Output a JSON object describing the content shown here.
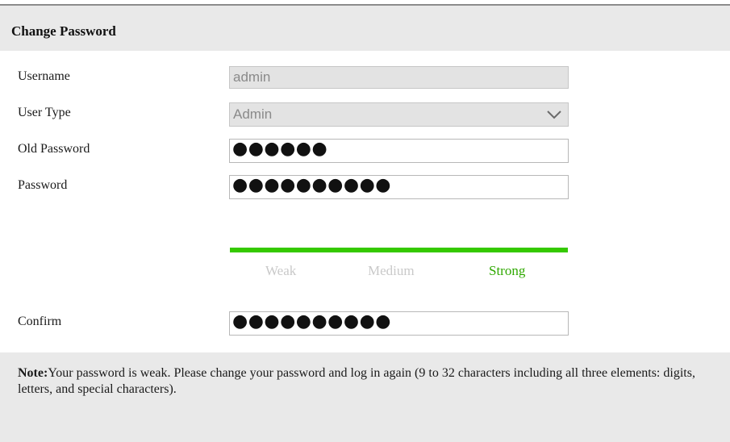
{
  "dialog": {
    "title": "Change Password"
  },
  "form": {
    "username_label": "Username",
    "username_value": "admin",
    "user_type_label": "User Type",
    "user_type_value": "Admin",
    "old_password_label": "Old Password",
    "old_password_mask": "●●●●●●",
    "password_label": "Password",
    "password_mask": "●●●●●●●●●●",
    "confirm_label": "Confirm",
    "confirm_mask": "●●●●●●●●●●"
  },
  "strength": {
    "weak_label": "Weak",
    "medium_label": "Medium",
    "strong_label": "Strong",
    "active_level": "Strong",
    "bar_color": "#35c900",
    "active_color": "#2fa800"
  },
  "note": {
    "prefix": "Note:",
    "text": "Your password is weak. Please change your password and log in again (9 to 32 characters including all three elements: digits, letters, and special characters)."
  },
  "icons": {
    "dropdown": "chevron-down-icon"
  }
}
